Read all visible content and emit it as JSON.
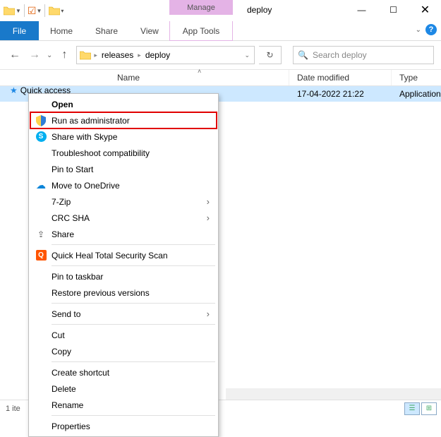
{
  "window": {
    "manage_label": "Manage",
    "title": "deploy"
  },
  "ribbon": {
    "file": "File",
    "home": "Home",
    "share": "Share",
    "view": "View",
    "app_tools": "App Tools"
  },
  "address": {
    "crumb1": "releases",
    "crumb2": "deploy"
  },
  "search": {
    "placeholder": "Search deploy"
  },
  "columns": {
    "name": "Name",
    "date": "Date modified",
    "type": "Type"
  },
  "row": {
    "date": "17-04-2022 21:22",
    "type": "Application"
  },
  "navpane": {
    "quick_access": "Quick access"
  },
  "menu": {
    "open": "Open",
    "run_admin": "Run as administrator",
    "share_skype": "Share with Skype",
    "troubleshoot": "Troubleshoot compatibility",
    "pin_start": "Pin to Start",
    "onedrive": "Move to OneDrive",
    "sevenzip": "7-Zip",
    "crc": "CRC SHA",
    "share": "Share",
    "quickheal": "Quick Heal Total Security Scan",
    "pin_taskbar": "Pin to taskbar",
    "restore": "Restore previous versions",
    "send_to": "Send to",
    "cut": "Cut",
    "copy": "Copy",
    "shortcut": "Create shortcut",
    "delete": "Delete",
    "rename": "Rename",
    "properties": "Properties"
  },
  "status": {
    "text": "1 ite"
  }
}
